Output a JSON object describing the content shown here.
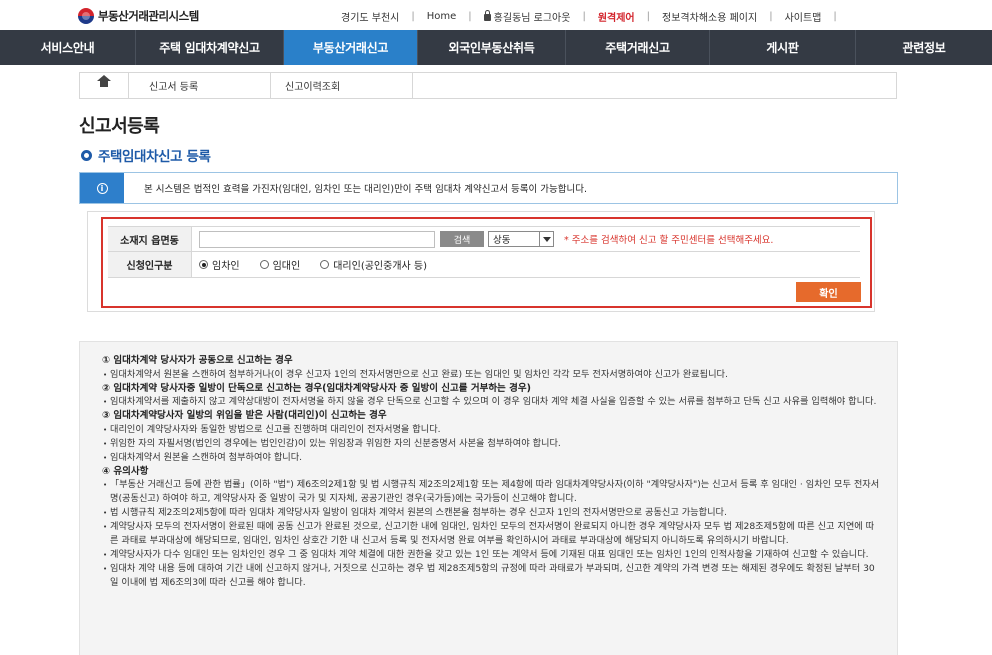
{
  "header": {
    "logo_text": "부동산거래관리시스템",
    "utility": {
      "region": "경기도 부천시",
      "home": "Home",
      "logout": "홍길동님 로그아웃",
      "remote": "원격제어",
      "accessibility": "정보격차해소용 페이지",
      "sitemap": "사이트맵"
    }
  },
  "nav": {
    "items": [
      "서비스안내",
      "주택 임대차계약신고",
      "부동산거래신고",
      "외국인부동산취득",
      "주택거래신고",
      "게시판",
      "관련정보"
    ],
    "active_index": 2,
    "active_color": "#2a80c9"
  },
  "breadcrumb": {
    "items": [
      "신고서 등록",
      "신고이력조회"
    ]
  },
  "page": {
    "title": "신고서등록",
    "section_title": "주택임대차신고 등록"
  },
  "banner": {
    "text": "본 시스템은 법적인 효력을 가진자(임대인, 임차인 또는 대리인)만이 주택 임대차 계약신고서 등록이 가능합니다."
  },
  "form": {
    "address_label": "소재지 읍면동",
    "address_value": "",
    "search_button": "검색",
    "select_value": "상동",
    "hint": "* 주소를 검색하여 신고 할 주민센터를 선택해주세요.",
    "applicant_label": "신청인구분",
    "applicant_options": [
      "임차인",
      "임대인",
      "대리인(공인중개사 등)"
    ],
    "applicant_selected_index": 0,
    "confirm_button": "확인"
  },
  "notes": {
    "s1_title": "① 임대차계약 당사자가 공동으로 신고하는 경우",
    "s1_b1": "임대차계약서 원본을 스캔하여 첨부하거나(이 경우 신고자 1인의 전자서명만으로 신고 완료) 또는 임대인 및 임차인 각각 모두 전자서명하여야 신고가 완료됩니다.",
    "s2_title": "② 임대차계약 당사자중 일방이 단독으로 신고하는 경우(임대차계약당사자 중 일방이 신고를 거부하는 경우)",
    "s2_b1": "임대차계약서를 제출하지 않고 계약상대방이 전자서명을 하지 않을 경우 단독으로 신고할 수 있으며 이 경우 임대차 계약 체결 사실을 입증할 수 있는 서류를 첨부하고 단독 신고 사유를 입력해야 합니다.",
    "s3_title": "③ 임대차계약당사자 일방의 위임을 받은 사람(대리인)이 신고하는 경우",
    "s3_b1": "대리인이 계약당사자와 동일한 방법으로 신고를 진행하며 대리인이 전자서명을 합니다.",
    "s3_b2": "위임한 자의 자필서명(법인의 경우에는 법인인감)이 있는 위임장과 위임한 자의 신분증명서 사본을 첨부하여야 합니다.",
    "s3_b3": "임대차계약서 원본을 스캔하여 첨부하여야 합니다.",
    "s4_title": "④ 유의사항",
    "s4_b1": "「부동산 거래신고 등에 관한 법률」(이하 \"법\") 제6조의2제1항 및 법 시행규칙 제2조의2제1항 또는 제4항에 따라 임대차계약당사자(이하 \"계약당사자\")는 신고서 등록 후 임대인 · 임차인 모두 전자서명(공동신고) 하여야 하고, 계약당사자 중 일방이 국가 및 지자체, 공공기관인 경우(국가등)에는 국가등이 신고해야 합니다.",
    "s4_b2": "법 시행규칙 제2조의2제5항에 따라 임대차 계약당사자 일방이 임대차 계약서 원본의 스캔본을 첨부하는 경우 신고자 1인의 전자서명만으로 공동신고 가능합니다.",
    "s4_b3": "계약당사자 모두의 전자서명이 완료된 때에 공동 신고가 완료된 것으로, 신고기한 내에 임대인, 임차인 모두의 전자서명이 완료되지 아니한 경우 계약당사자 모두 법 제28조제5항에 따른 신고 지연에 따른 과태료 부과대상에 해당되므로, 임대인, 임차인 상호간 기한 내 신고서 등록 및 전자서명 완료 여부를 확인하시어 과태료 부과대상에 해당되지 아니하도록 유의하시기 바랍니다.",
    "s4_b4": "계약당사자가 다수 임대인 또는 임차인인 경우 그 중 임대차 계약 체결에 대한 권한을 갖고 있는 1인 또는 계약서 등에 기재된 대표 임대인 또는 임차인 1인의 인적사항을 기재하여 신고할 수 있습니다.",
    "s4_b5": "임대차 계약 내용 등에 대하여 기간 내에 신고하지 않거나, 거짓으로 신고하는 경우 법 제28조제5항의 규정에 따라 과태료가 부과되며, 신고한 계약의 가격 변경 또는 해제된 경우에도 확정된 날부터 30일 이내에 법 제6조의3에 따라 신고를 해야 합니다."
  }
}
